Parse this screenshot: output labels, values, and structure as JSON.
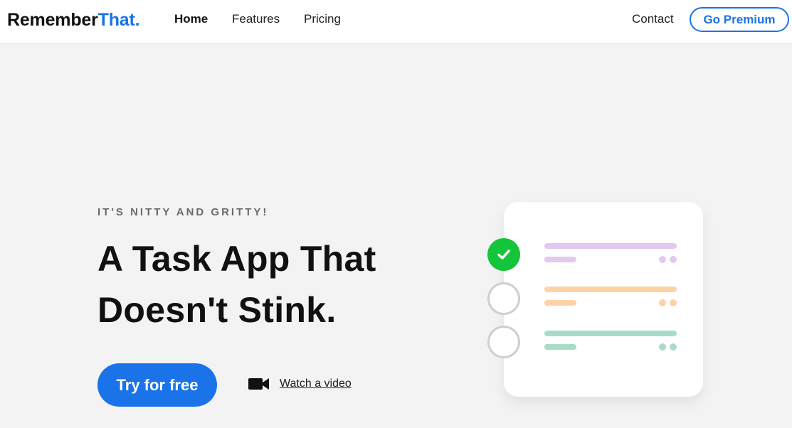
{
  "nav": {
    "logo_part1": "Remember",
    "logo_part2": "That.",
    "links": [
      {
        "label": "Home",
        "active": true
      },
      {
        "label": "Features",
        "active": false
      },
      {
        "label": "Pricing",
        "active": false
      }
    ],
    "contact_label": "Contact",
    "premium_label": "Go Premium"
  },
  "hero": {
    "eyebrow": "IT'S NITTY AND GRITTY!",
    "headline_line1": "A Task App That",
    "headline_line2": "Doesn't Stink.",
    "cta_label": "Try for free",
    "video_label": "Watch a video",
    "video_icon": "video-camera-icon"
  },
  "illustration": {
    "tasks": [
      {
        "state": "done",
        "color": "#e3c8ef"
      },
      {
        "state": "open",
        "color": "#fdd3a6"
      },
      {
        "state": "open",
        "color": "#a9dcc6"
      }
    ],
    "check_color": "#14c43a"
  },
  "colors": {
    "accent": "#1a73e8",
    "background": "#f3f3f3"
  }
}
